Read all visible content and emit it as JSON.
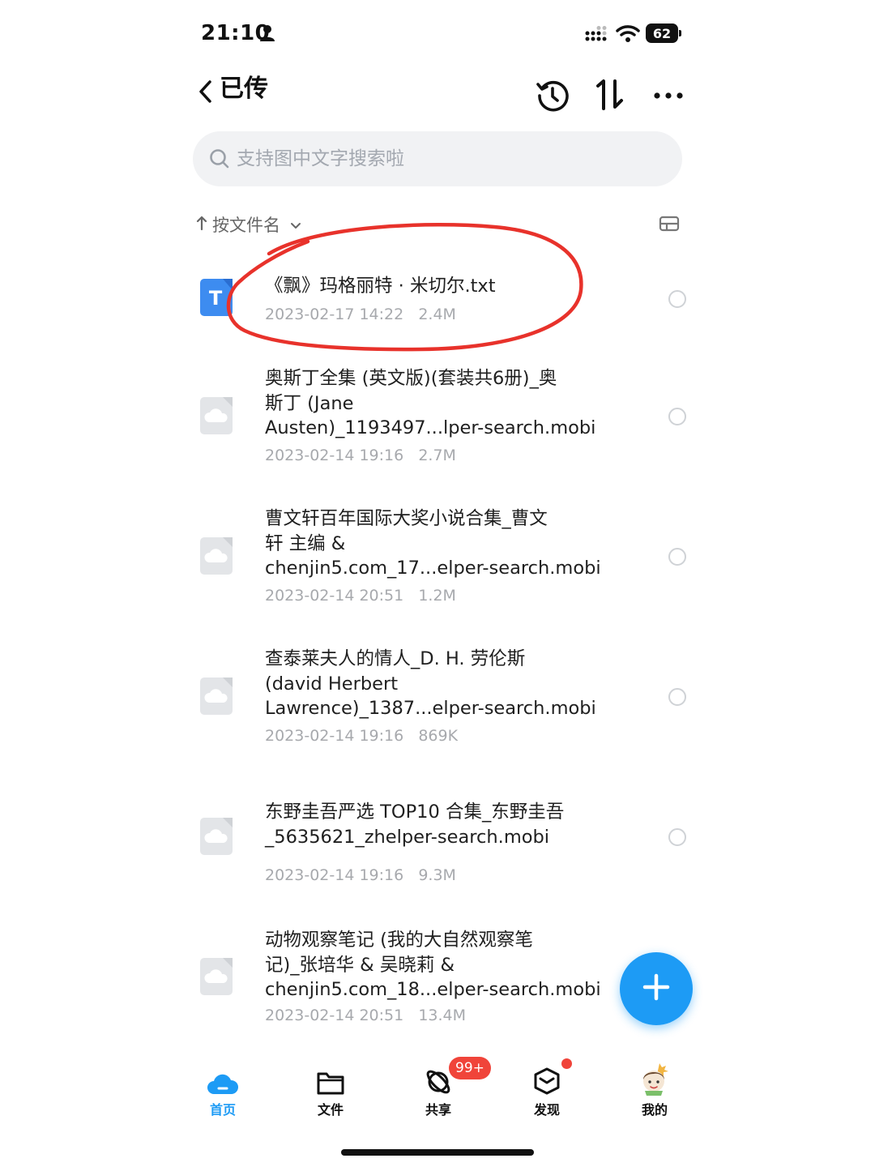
{
  "status_bar": {
    "time": "21:10",
    "battery": "62"
  },
  "header": {
    "title": "已传"
  },
  "search": {
    "placeholder": "支持图中文字搜索啦"
  },
  "sort": {
    "label": "按文件名"
  },
  "files": [
    {
      "name": "《飘》玛格丽特 · 米切尔.txt",
      "date": "2023-02-17 14:22",
      "size": "2.4M",
      "type": "txt"
    },
    {
      "name": "奥斯丁全集 (英文版)(套装共6册)_奥\n斯丁 (Jane\nAusten)_1193497...lper-search.mobi",
      "date": "2023-02-14 19:16",
      "size": "2.7M",
      "type": "cloud"
    },
    {
      "name": "曹文轩百年国际大奖小说合集_曹文\n轩 主编 &\nchenjin5.com_17...elper-search.mobi",
      "date": "2023-02-14 20:51",
      "size": "1.2M",
      "type": "cloud"
    },
    {
      "name": "查泰莱夫人的情人_D. H. 劳伦斯\n(david Herbert\nLawrence)_1387...elper-search.mobi",
      "date": "2023-02-14 19:16",
      "size": "869K",
      "type": "cloud"
    },
    {
      "name": "东野圭吾严选 TOP10 合集_东野圭吾\n_5635621_zhelper-search.mobi",
      "date": "2023-02-14 19:16",
      "size": "9.3M",
      "type": "cloud"
    },
    {
      "name": "动物观察笔记 (我的大自然观察笔\n记)_张培华 & 吴晓莉 &\nchenjin5.com_18...elper-search.mobi",
      "date": "2023-02-14 20:51",
      "size": "13.4M",
      "type": "cloud"
    }
  ],
  "nav": {
    "home": "首页",
    "files": "文件",
    "share": "共享",
    "share_badge": "99+",
    "discover": "发现",
    "mine": "我的"
  },
  "colors": {
    "accent": "#1d9bf5",
    "badge": "#f0443a",
    "annotation": "#e8322b"
  }
}
